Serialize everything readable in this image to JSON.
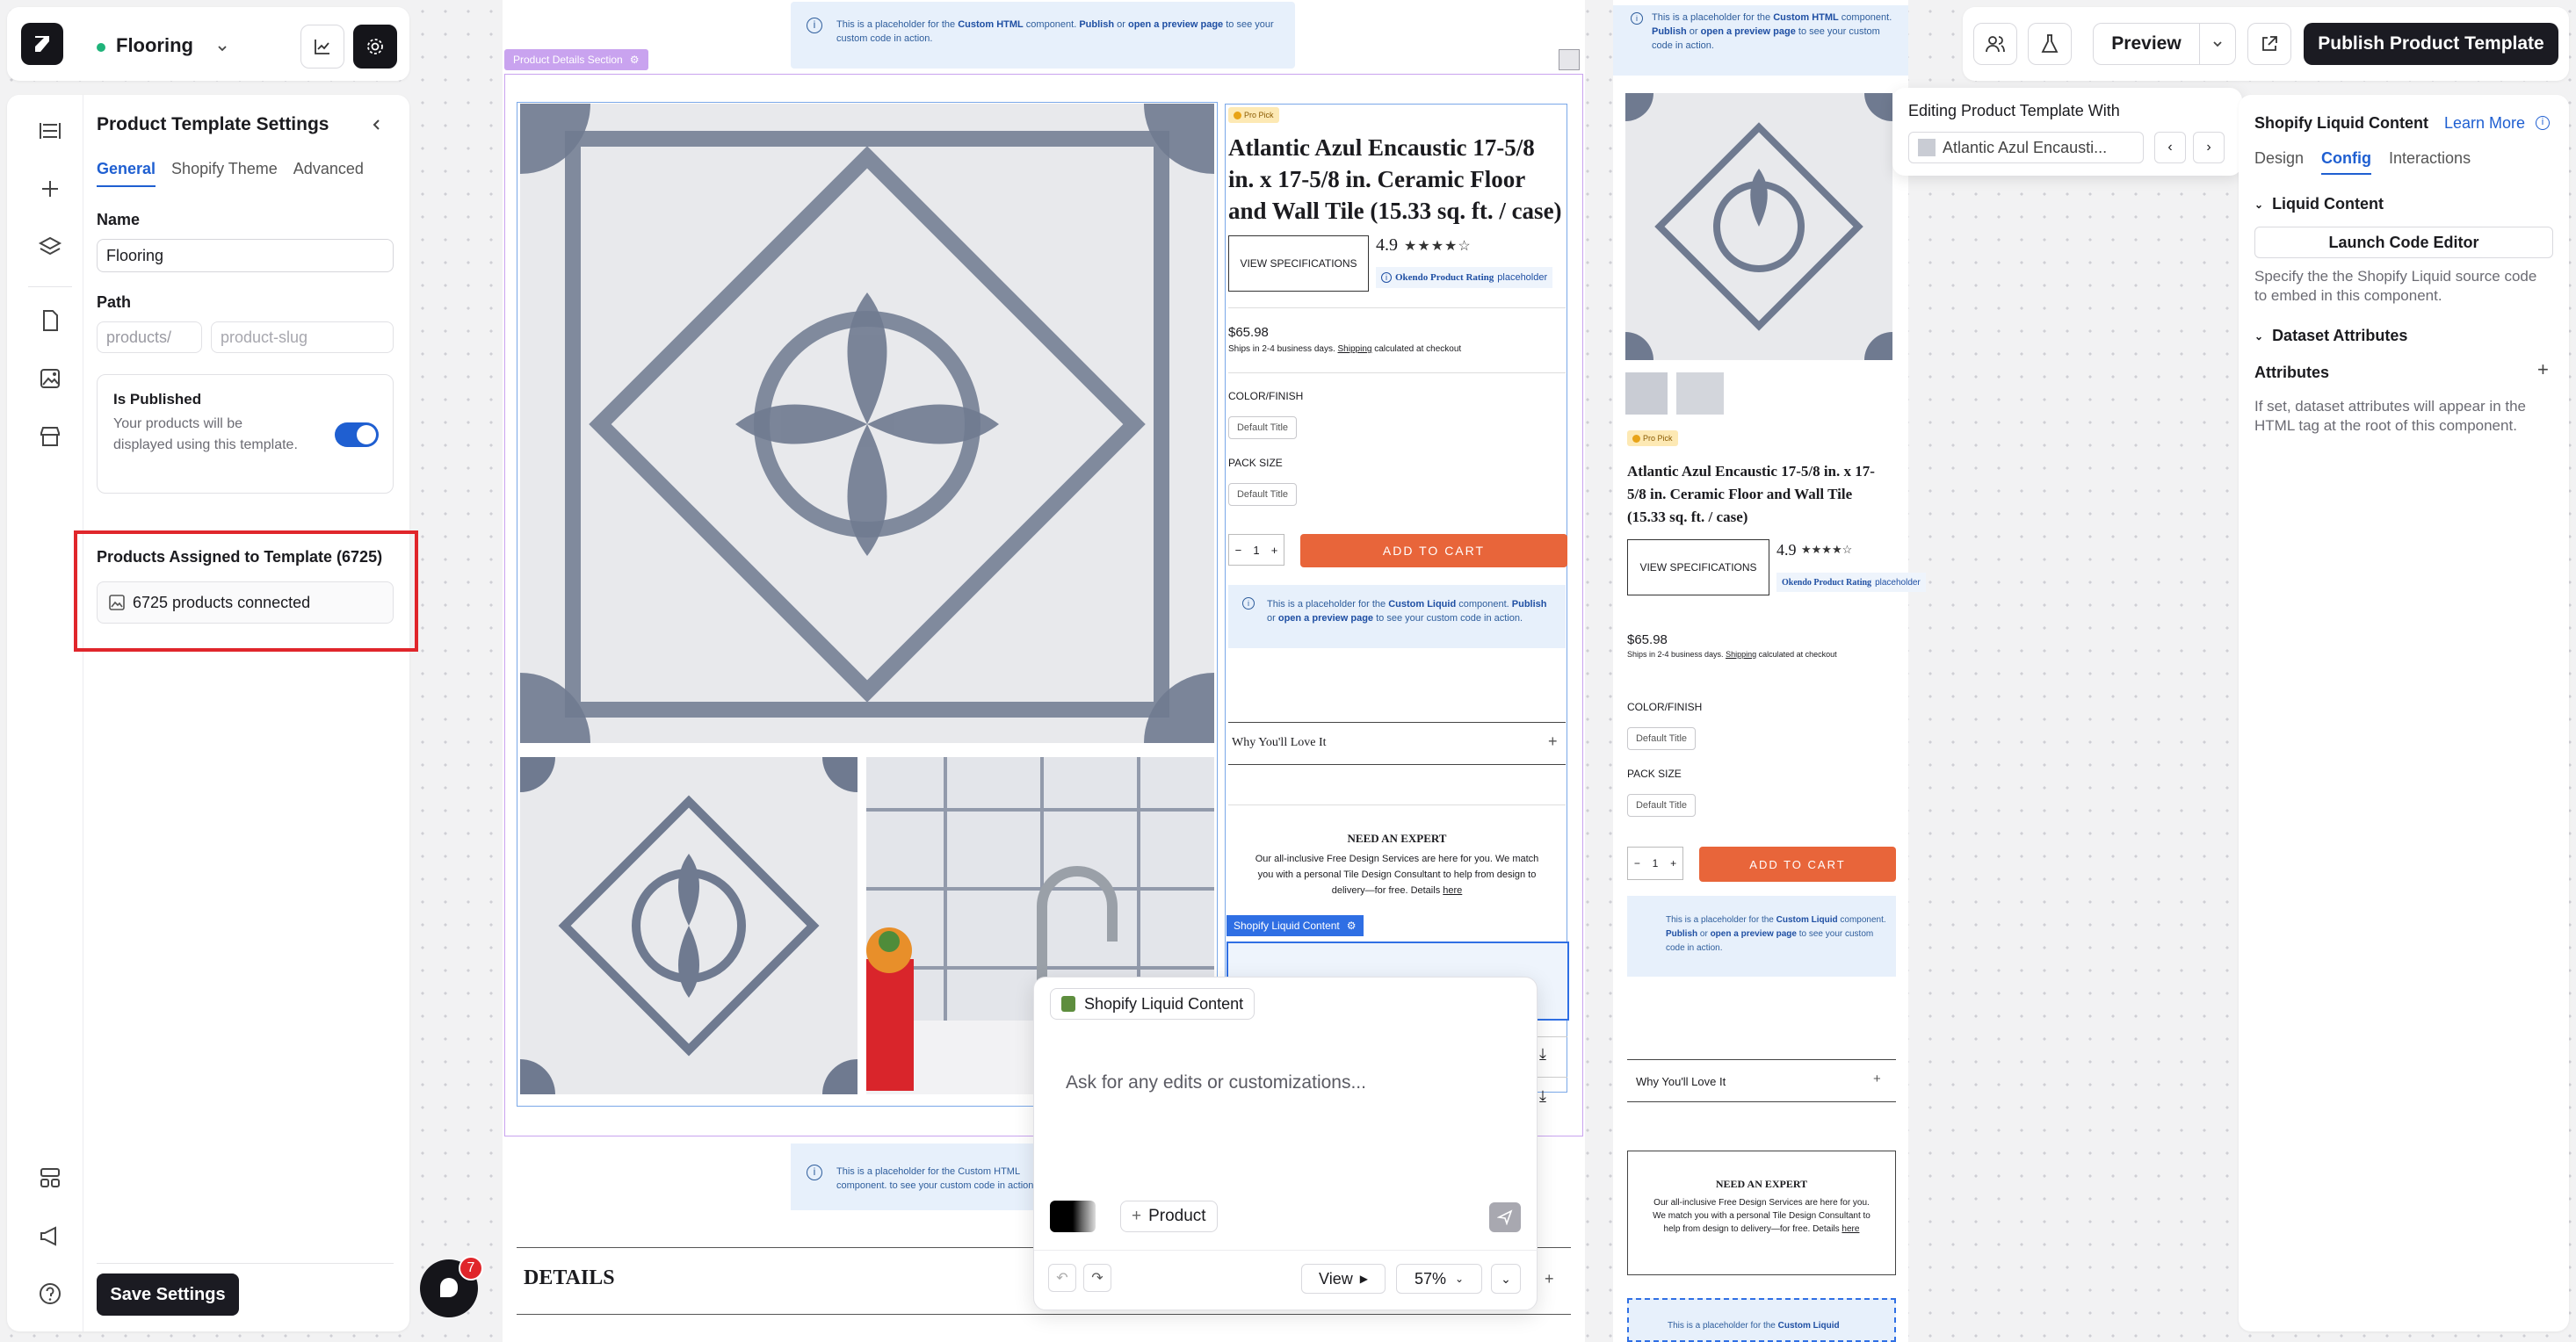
{
  "app": {
    "title": "Flooring",
    "status_color": "#1fb37a"
  },
  "topbar": {
    "preview_label": "Preview",
    "publish_label": "Publish Product Template"
  },
  "left": {
    "title": "Product Template Settings",
    "tabs": [
      {
        "label": "General",
        "active": true
      },
      {
        "label": "Shopify Theme",
        "active": false
      },
      {
        "label": "Advanced",
        "active": false
      }
    ],
    "name_label": "Name",
    "name_value": "Flooring",
    "path_label": "Path",
    "path_prefix": "products/",
    "path_placeholder": "product-slug",
    "published_label": "Is Published",
    "published_desc": "Your products will be displayed using this template.",
    "published_on": true,
    "assigned_title": "Products Assigned to Template (6725)",
    "assigned_value": "6725 products connected",
    "save_label": "Save Settings",
    "notif_count": "7"
  },
  "canvas": {
    "ph_top": {
      "pre": "This is a placeholder for the ",
      "c1": "Custom HTML",
      "mid": " component. ",
      "c2": "Publish",
      "or": " or ",
      "c3": "open a preview page",
      "post": " to see your custom code in action."
    },
    "section_tag": "Product Details Section",
    "badge": "Pro Pick",
    "product_title": "Atlantic Azul Encaustic 17-5/8 in. x 17-5/8 in. Ceramic Floor and Wall Tile (15.33 sq. ft. / case)",
    "view_specs": "VIEW SPECIFICATIONS",
    "rating": "4.9",
    "rating_placeholder": "Okendo Product Rating",
    "rating_ph_suffix": "placeholder",
    "price": "$65.98",
    "ship_pre": "Ships in 2-4 business days. ",
    "ship_link": "Shipping",
    "ship_post": " calculated at checkout",
    "color_label": "COLOR/FINISH",
    "default_title": "Default Title",
    "pack_label": "PACK SIZE",
    "qty": "1",
    "add_to_cart": "ADD TO CART",
    "ph_liquid": {
      "pre": "This is a placeholder for the ",
      "c1": "Custom Liquid",
      "mid": " component. ",
      "c2": "Publish",
      "or": " or ",
      "c3": "open a preview page",
      "post": " to see your custom code in action."
    },
    "why_love": "Why You'll Love It",
    "expert_title": "NEED AN EXPERT",
    "expert_text": "Our all-inclusive Free Design Services are here for you. We match you with a personal Tile Design Consultant to help from design to delivery—for free. Details ",
    "expert_link": "here",
    "liquid_tag": "Shopify Liquid Content",
    "details": "DETAILS"
  },
  "ai": {
    "chip": "Shopify Liquid Content",
    "placeholder": "Ask for any edits or customizations...",
    "product_btn": "Product",
    "view_label": "View",
    "zoom": "57%"
  },
  "preview": {
    "editing_label": "Editing Product Template With",
    "product_short": "Atlantic Azul Encausti...",
    "product_title": "Atlantic Azul Encaustic 17-5/8 in. x 17-5/8 in. Ceramic Floor and Wall Tile (15.33 sq. ft. / case)",
    "expert_text": "Our all-inclusive Free Design Services are here for you. We match you with a personal Tile Design Consultant to help from design to delivery—for free. Details "
  },
  "right": {
    "title": "Shopify Liquid Content",
    "learn_more": "Learn More",
    "tabs": [
      {
        "label": "Design",
        "active": false
      },
      {
        "label": "Config",
        "active": true
      },
      {
        "label": "Interactions",
        "active": false
      }
    ],
    "liquid_section": "Liquid Content",
    "launch_btn": "Launch Code Editor",
    "liquid_desc": "Specify the the Shopify Liquid source code to embed in this component.",
    "dataset_section": "Dataset Attributes",
    "attributes_label": "Attributes",
    "attributes_desc": "If set, dataset attributes will appear in the HTML tag at the root of this component."
  },
  "colors": {
    "accent": "#1f5fd1",
    "cta": "#e8653a",
    "dark": "#1b1b22",
    "highlight": "#e0262b",
    "tag_purple": "#c9a3ef",
    "tag_blue": "#2f6fe4"
  }
}
